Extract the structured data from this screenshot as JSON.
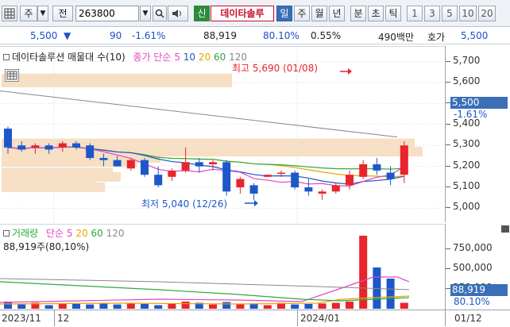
{
  "toolbar": {
    "order_type": "주",
    "order_arrow": "▼",
    "prev_label": "전",
    "code": "263800",
    "btn_new": "신",
    "stock_name": "데이타솔루",
    "periods": [
      "일",
      "주",
      "월",
      "년",
      "분",
      "초",
      "틱"
    ],
    "active_period": "일",
    "numbers": [
      "1",
      "3",
      "5",
      "10",
      "20"
    ]
  },
  "info": {
    "price": "5,500",
    "change_arrow": "▼",
    "change": "90",
    "change_pct": "-1.61%",
    "volume": "88,919",
    "ratio": "80.10%",
    "turnover": "0.55%",
    "amount": "490백만",
    "quote_label": "호가",
    "quote": "5,500"
  },
  "price_panel": {
    "legend_name": "데이타솔루션 매물대 수(10)",
    "legend_ma_label": "종가 단순",
    "legend_ma": [
      "5",
      "10",
      "20",
      "60",
      "120"
    ],
    "high_label": "최고 5,690 (01/08)",
    "low_label": "최저 5,040 (12/26)"
  },
  "volume_panel": {
    "legend_name": "거래량",
    "legend_ma_label": "단순",
    "legend_ma": [
      "5",
      "20",
      "60",
      "120"
    ],
    "volume_text": "88,919주(80,10%)"
  },
  "price_axis": {
    "labels": [
      "5,700",
      "5,600",
      "5,500",
      "5,400",
      "5,300",
      "5,200",
      "5,100",
      "5,000"
    ],
    "current_price": "5,500",
    "current_change": "-1.61%"
  },
  "volume_axis": {
    "labels": [
      "750,000",
      "500,000",
      "250,000"
    ],
    "current_volume": "88,919",
    "current_ratio": "80.10%"
  },
  "date_axis": {
    "labels": [
      "2023/11",
      "12",
      "2024/01",
      "01/12"
    ]
  },
  "colors": {
    "up": "#e8242c",
    "down": "#1d57c9",
    "ma5": "#e046c8",
    "ma10": "#1d57c9",
    "ma20": "#e8a400",
    "ma60": "#2fa83c",
    "ma120": "#888888",
    "volume_profile": "#f6dfc3"
  },
  "chart_data": {
    "type": "candlestick",
    "series": [
      {
        "date": "11/29",
        "open": 5380,
        "high": 5390,
        "low": 5260,
        "close": 5290
      },
      {
        "date": "11/30",
        "open": 5300,
        "high": 5320,
        "low": 5270,
        "close": 5280
      },
      {
        "date": "12/01",
        "open": 5290,
        "high": 5310,
        "low": 5260,
        "close": 5300
      },
      {
        "date": "12/04",
        "open": 5300,
        "high": 5310,
        "low": 5260,
        "close": 5280
      },
      {
        "date": "12/05",
        "open": 5290,
        "high": 5320,
        "low": 5270,
        "close": 5310
      },
      {
        "date": "12/06",
        "open": 5310,
        "high": 5320,
        "low": 5280,
        "close": 5290
      },
      {
        "date": "12/07",
        "open": 5300,
        "high": 5310,
        "low": 5230,
        "close": 5240
      },
      {
        "date": "12/08",
        "open": 5240,
        "high": 5260,
        "low": 5200,
        "close": 5230
      },
      {
        "date": "12/11",
        "open": 5230,
        "high": 5250,
        "low": 5200,
        "close": 5200
      },
      {
        "date": "12/12",
        "open": 5190,
        "high": 5240,
        "low": 5180,
        "close": 5230
      },
      {
        "date": "12/13",
        "open": 5230,
        "high": 5240,
        "low": 5150,
        "close": 5160
      },
      {
        "date": "12/14",
        "open": 5160,
        "high": 5200,
        "low": 5100,
        "close": 5110
      },
      {
        "date": "12/15",
        "open": 5150,
        "high": 5190,
        "low": 5130,
        "close": 5180
      },
      {
        "date": "12/18",
        "open": 5180,
        "high": 5290,
        "low": 5170,
        "close": 5220
      },
      {
        "date": "12/19",
        "open": 5220,
        "high": 5240,
        "low": 5170,
        "close": 5200
      },
      {
        "date": "12/20",
        "open": 5210,
        "high": 5230,
        "low": 5180,
        "close": 5220
      },
      {
        "date": "12/21",
        "open": 5220,
        "high": 5230,
        "low": 5060,
        "close": 5080
      },
      {
        "date": "12/22",
        "open": 5100,
        "high": 5150,
        "low": 5070,
        "close": 5140
      },
      {
        "date": "12/26",
        "open": 5110,
        "high": 5120,
        "low": 5040,
        "close": 5070
      },
      {
        "date": "12/27",
        "open": 5150,
        "high": 5160,
        "low": 5150,
        "close": 5160
      },
      {
        "date": "12/28",
        "open": 5170,
        "high": 5180,
        "low": 5150,
        "close": 5170
      },
      {
        "date": "01/02",
        "open": 5170,
        "high": 5180,
        "low": 5090,
        "close": 5100
      },
      {
        "date": "01/03",
        "open": 5100,
        "high": 5140,
        "low": 5060,
        "close": 5080
      },
      {
        "date": "01/04",
        "open": 5070,
        "high": 5090,
        "low": 5040,
        "close": 5080
      },
      {
        "date": "01/05",
        "open": 5080,
        "high": 5120,
        "low": 5070,
        "close": 5110
      },
      {
        "date": "01/08",
        "open": 5110,
        "high": 5180,
        "low": 5090,
        "close": 5160
      },
      {
        "date": "01/09",
        "open": 5150,
        "high": 5230,
        "low": 5140,
        "close": 5210
      },
      {
        "date": "01/10",
        "open": 5210,
        "high": 5240,
        "low": 5160,
        "close": 5180
      },
      {
        "date": "01/11",
        "open": 5170,
        "high": 5200,
        "low": 5110,
        "close": 5140
      },
      {
        "date": "01/12",
        "open": 5160,
        "high": 5320,
        "low": 5120,
        "close": 5300
      }
    ],
    "ylim": [
      4960,
      5740
    ]
  }
}
